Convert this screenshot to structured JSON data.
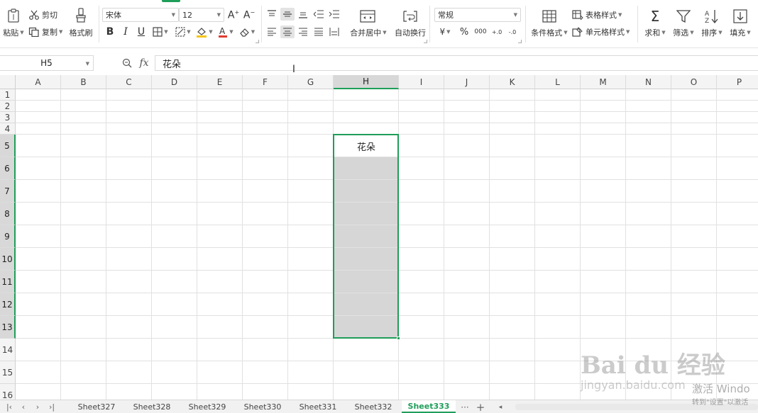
{
  "ribbon": {
    "clipboard": {
      "paste": "粘贴",
      "cut": "剪切",
      "copy": "复制",
      "format_painter": "格式刷"
    },
    "font": {
      "name": "宋体",
      "size": "12"
    },
    "alignment": {
      "merge_center": "合并居中",
      "wrap_text": "自动换行"
    },
    "number": {
      "format": "常规",
      "currency": "¥",
      "percent": "%",
      "thousands": "000",
      "inc_decimal": "+.0",
      "dec_decimal": "-.0"
    },
    "styles": {
      "conditional_format": "条件格式",
      "table_style": "表格样式",
      "cell_style": "单元格样式"
    },
    "editing": {
      "sum": "求和",
      "filter": "筛选",
      "sort": "排序",
      "fill": "填充"
    }
  },
  "formula_bar": {
    "cell_ref": "H5",
    "fx": "fx",
    "content": "花朵"
  },
  "grid": {
    "columns": [
      "A",
      "B",
      "C",
      "D",
      "E",
      "F",
      "G",
      "H",
      "I",
      "J",
      "K",
      "L",
      "M",
      "N",
      "O",
      "P"
    ],
    "rows": [
      "1",
      "2",
      "3",
      "4",
      "5",
      "6",
      "7",
      "8",
      "9",
      "10",
      "11",
      "12",
      "13",
      "14",
      "15",
      "16"
    ],
    "selected_column": "H",
    "selected_rows_from": 5,
    "selected_rows_to": 13,
    "cell_H5": "花朵"
  },
  "sheets": {
    "tabs": [
      "Sheet327",
      "Sheet328",
      "Sheet329",
      "Sheet330",
      "Sheet331",
      "Sheet332",
      "Sheet333"
    ],
    "active": "Sheet333",
    "more": "···",
    "add": "+"
  },
  "watermark": {
    "brand": "Bai du 经验",
    "url": "jingyan.baidu.com",
    "activate": "激活 Windo",
    "activate_sub": "转到\"设置\"以激活"
  },
  "colors": {
    "accent": "#1f9e5a",
    "selection_fill": "#d6d6d6",
    "font_color_red": "#e03c31",
    "highlight_yellow": "#f5c518"
  }
}
